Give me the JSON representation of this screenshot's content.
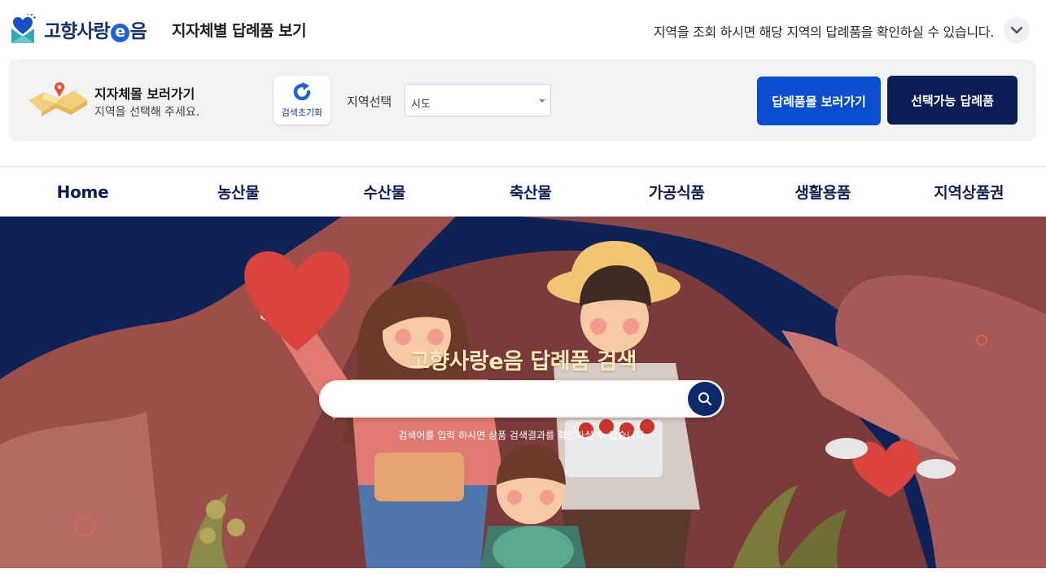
{
  "header": {
    "logo_text_1": "고향사랑",
    "logo_text_e": "e",
    "logo_text_2": "음",
    "page_title": "지자체별 답례품 보기",
    "info_text": "지역을 조회 하시면 해당 지역의 답례품을 확인하실 수 있습니다.",
    "toggle_icon": "chevron-down-icon"
  },
  "region_panel": {
    "title": "지자체몰 보러가기",
    "subtitle": "지역을 선택해 주세요.",
    "reset_label": "검색초기화",
    "region_label": "지역선택",
    "region_select_value": "시도",
    "button_gifts": "답례품몰 보러가기",
    "button_available": "선택가능 답례품"
  },
  "nav": {
    "items": [
      {
        "label": "Home"
      },
      {
        "label": "농산물"
      },
      {
        "label": "수산물"
      },
      {
        "label": "축산물"
      },
      {
        "label": "가공식품"
      },
      {
        "label": "생활용품"
      },
      {
        "label": "지역상품권"
      }
    ]
  },
  "hero": {
    "title": "고향사랑e음 답례품 검색",
    "search_value": "",
    "search_hint": "검색어를 입력 하시면 상품 검색결과를 확인하실 수 있습니다."
  },
  "colors": {
    "brand_navy": "#0c1d55",
    "brand_blue": "#0a4ed0",
    "hero_bg": "#0f2257",
    "hero_title": "#ffe8b8"
  }
}
